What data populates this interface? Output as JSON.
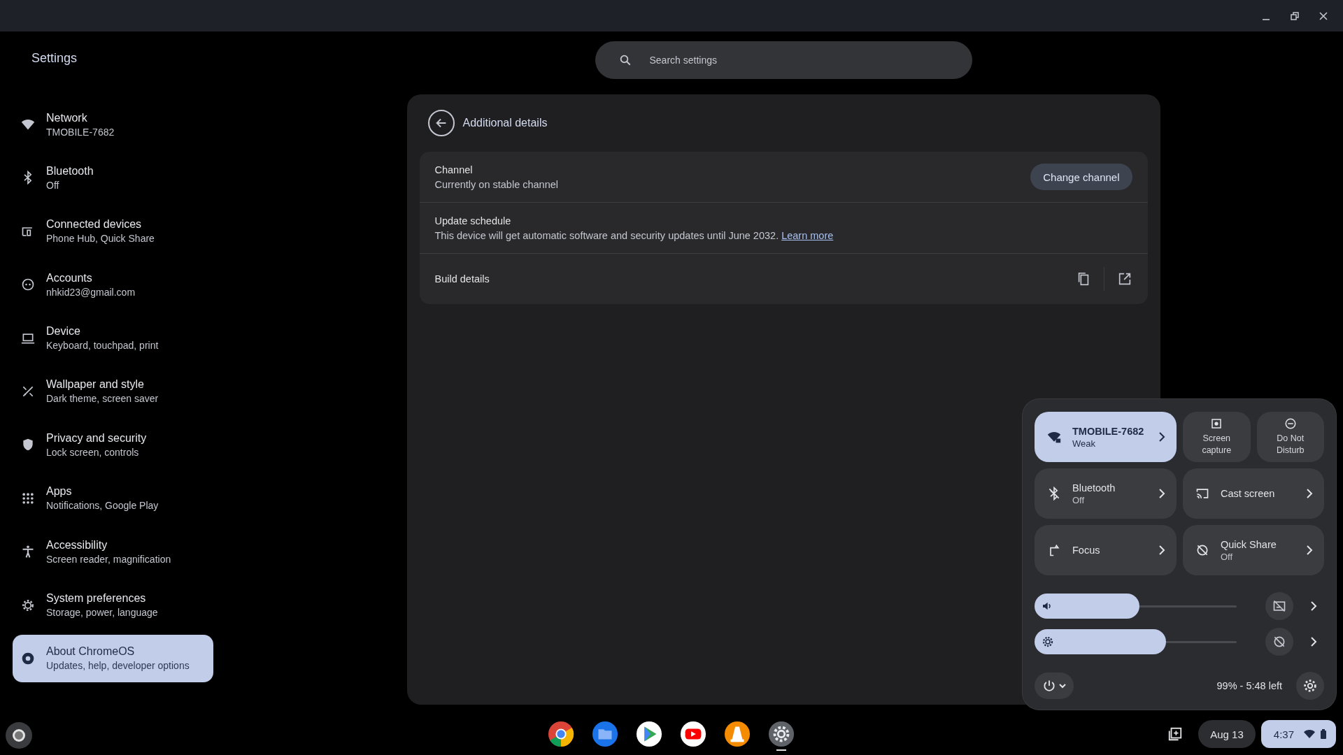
{
  "window": {
    "title": "Settings"
  },
  "search": {
    "placeholder": "Search settings"
  },
  "sidebar": {
    "items": [
      {
        "label": "Network",
        "sublabel": "TMOBILE-7682",
        "selected": false
      },
      {
        "label": "Bluetooth",
        "sublabel": "Off",
        "selected": false
      },
      {
        "label": "Connected devices",
        "sublabel": "Phone Hub, Quick Share",
        "selected": false
      },
      {
        "label": "Accounts",
        "sublabel": "nhkid23@gmail.com",
        "selected": false
      },
      {
        "label": "Device",
        "sublabel": "Keyboard, touchpad, print",
        "selected": false
      },
      {
        "label": "Wallpaper and style",
        "sublabel": "Dark theme, screen saver",
        "selected": false
      },
      {
        "label": "Privacy and security",
        "sublabel": "Lock screen, controls",
        "selected": false
      },
      {
        "label": "Apps",
        "sublabel": "Notifications, Google Play",
        "selected": false
      },
      {
        "label": "Accessibility",
        "sublabel": "Screen reader, magnification",
        "selected": false
      },
      {
        "label": "System preferences",
        "sublabel": "Storage, power, language",
        "selected": false
      },
      {
        "label": "About ChromeOS",
        "sublabel": "Updates, help, developer options",
        "selected": true
      }
    ]
  },
  "page": {
    "title": "Additional details",
    "rows": [
      {
        "kind": "button",
        "title": "Channel",
        "subtitle": "Currently on stable channel",
        "button": "Change channel"
      },
      {
        "kind": "link",
        "title": "Update schedule",
        "subtitle": "This device will get automatic software and security updates until June 2032.",
        "link": "Learn more"
      },
      {
        "kind": "actions",
        "title": "Build details"
      }
    ]
  },
  "quick_settings": {
    "tile_rows": [
      [
        {
          "label": "TMOBILE-7682",
          "sublabel": "Weak",
          "active": true,
          "kind": "wide"
        },
        {
          "label": "Screen capture",
          "active": false,
          "kind": "small"
        },
        {
          "label": "Do Not Disturb",
          "active": false,
          "kind": "small"
        }
      ],
      [
        {
          "label": "Bluetooth",
          "sublabel": "Off",
          "active": false,
          "kind": "wide"
        },
        {
          "label": "Cast screen",
          "active": false,
          "kind": "wide"
        }
      ],
      [
        {
          "label": "Focus",
          "active": false,
          "kind": "wide"
        },
        {
          "label": "Quick Share",
          "sublabel": "Off",
          "active": false,
          "kind": "wide"
        }
      ]
    ],
    "sliders": [
      {
        "kind": "volume",
        "level": 0.52
      },
      {
        "kind": "brightness",
        "level": 0.65
      }
    ],
    "battery": "99% - 5:48 left"
  },
  "shelf": {
    "apps": [
      {
        "kind": "chrome",
        "active": false
      },
      {
        "kind": "files",
        "active": false
      },
      {
        "kind": "play",
        "active": false
      },
      {
        "kind": "youtube",
        "active": false
      },
      {
        "kind": "vlc",
        "active": false
      },
      {
        "kind": "settings",
        "active": true
      }
    ],
    "date": "Aug 13",
    "time": "4:37"
  }
}
